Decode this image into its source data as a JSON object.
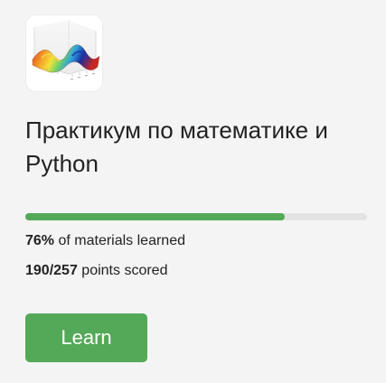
{
  "course": {
    "title": "Практикум по математике и Python",
    "thumbnail": "3d-surface-plot-image"
  },
  "progress": {
    "materials_percent": 76,
    "materials_percent_text": "76%",
    "materials_label": "of materials learned",
    "points_text": "190/257",
    "points_scored": 190,
    "points_total": 257,
    "points_label": "points scored"
  },
  "actions": {
    "learn_label": "Learn"
  },
  "colors": {
    "accent": "#53a957",
    "track": "#e3e3e3",
    "background": "#f4f4f4",
    "text": "#222222"
  }
}
